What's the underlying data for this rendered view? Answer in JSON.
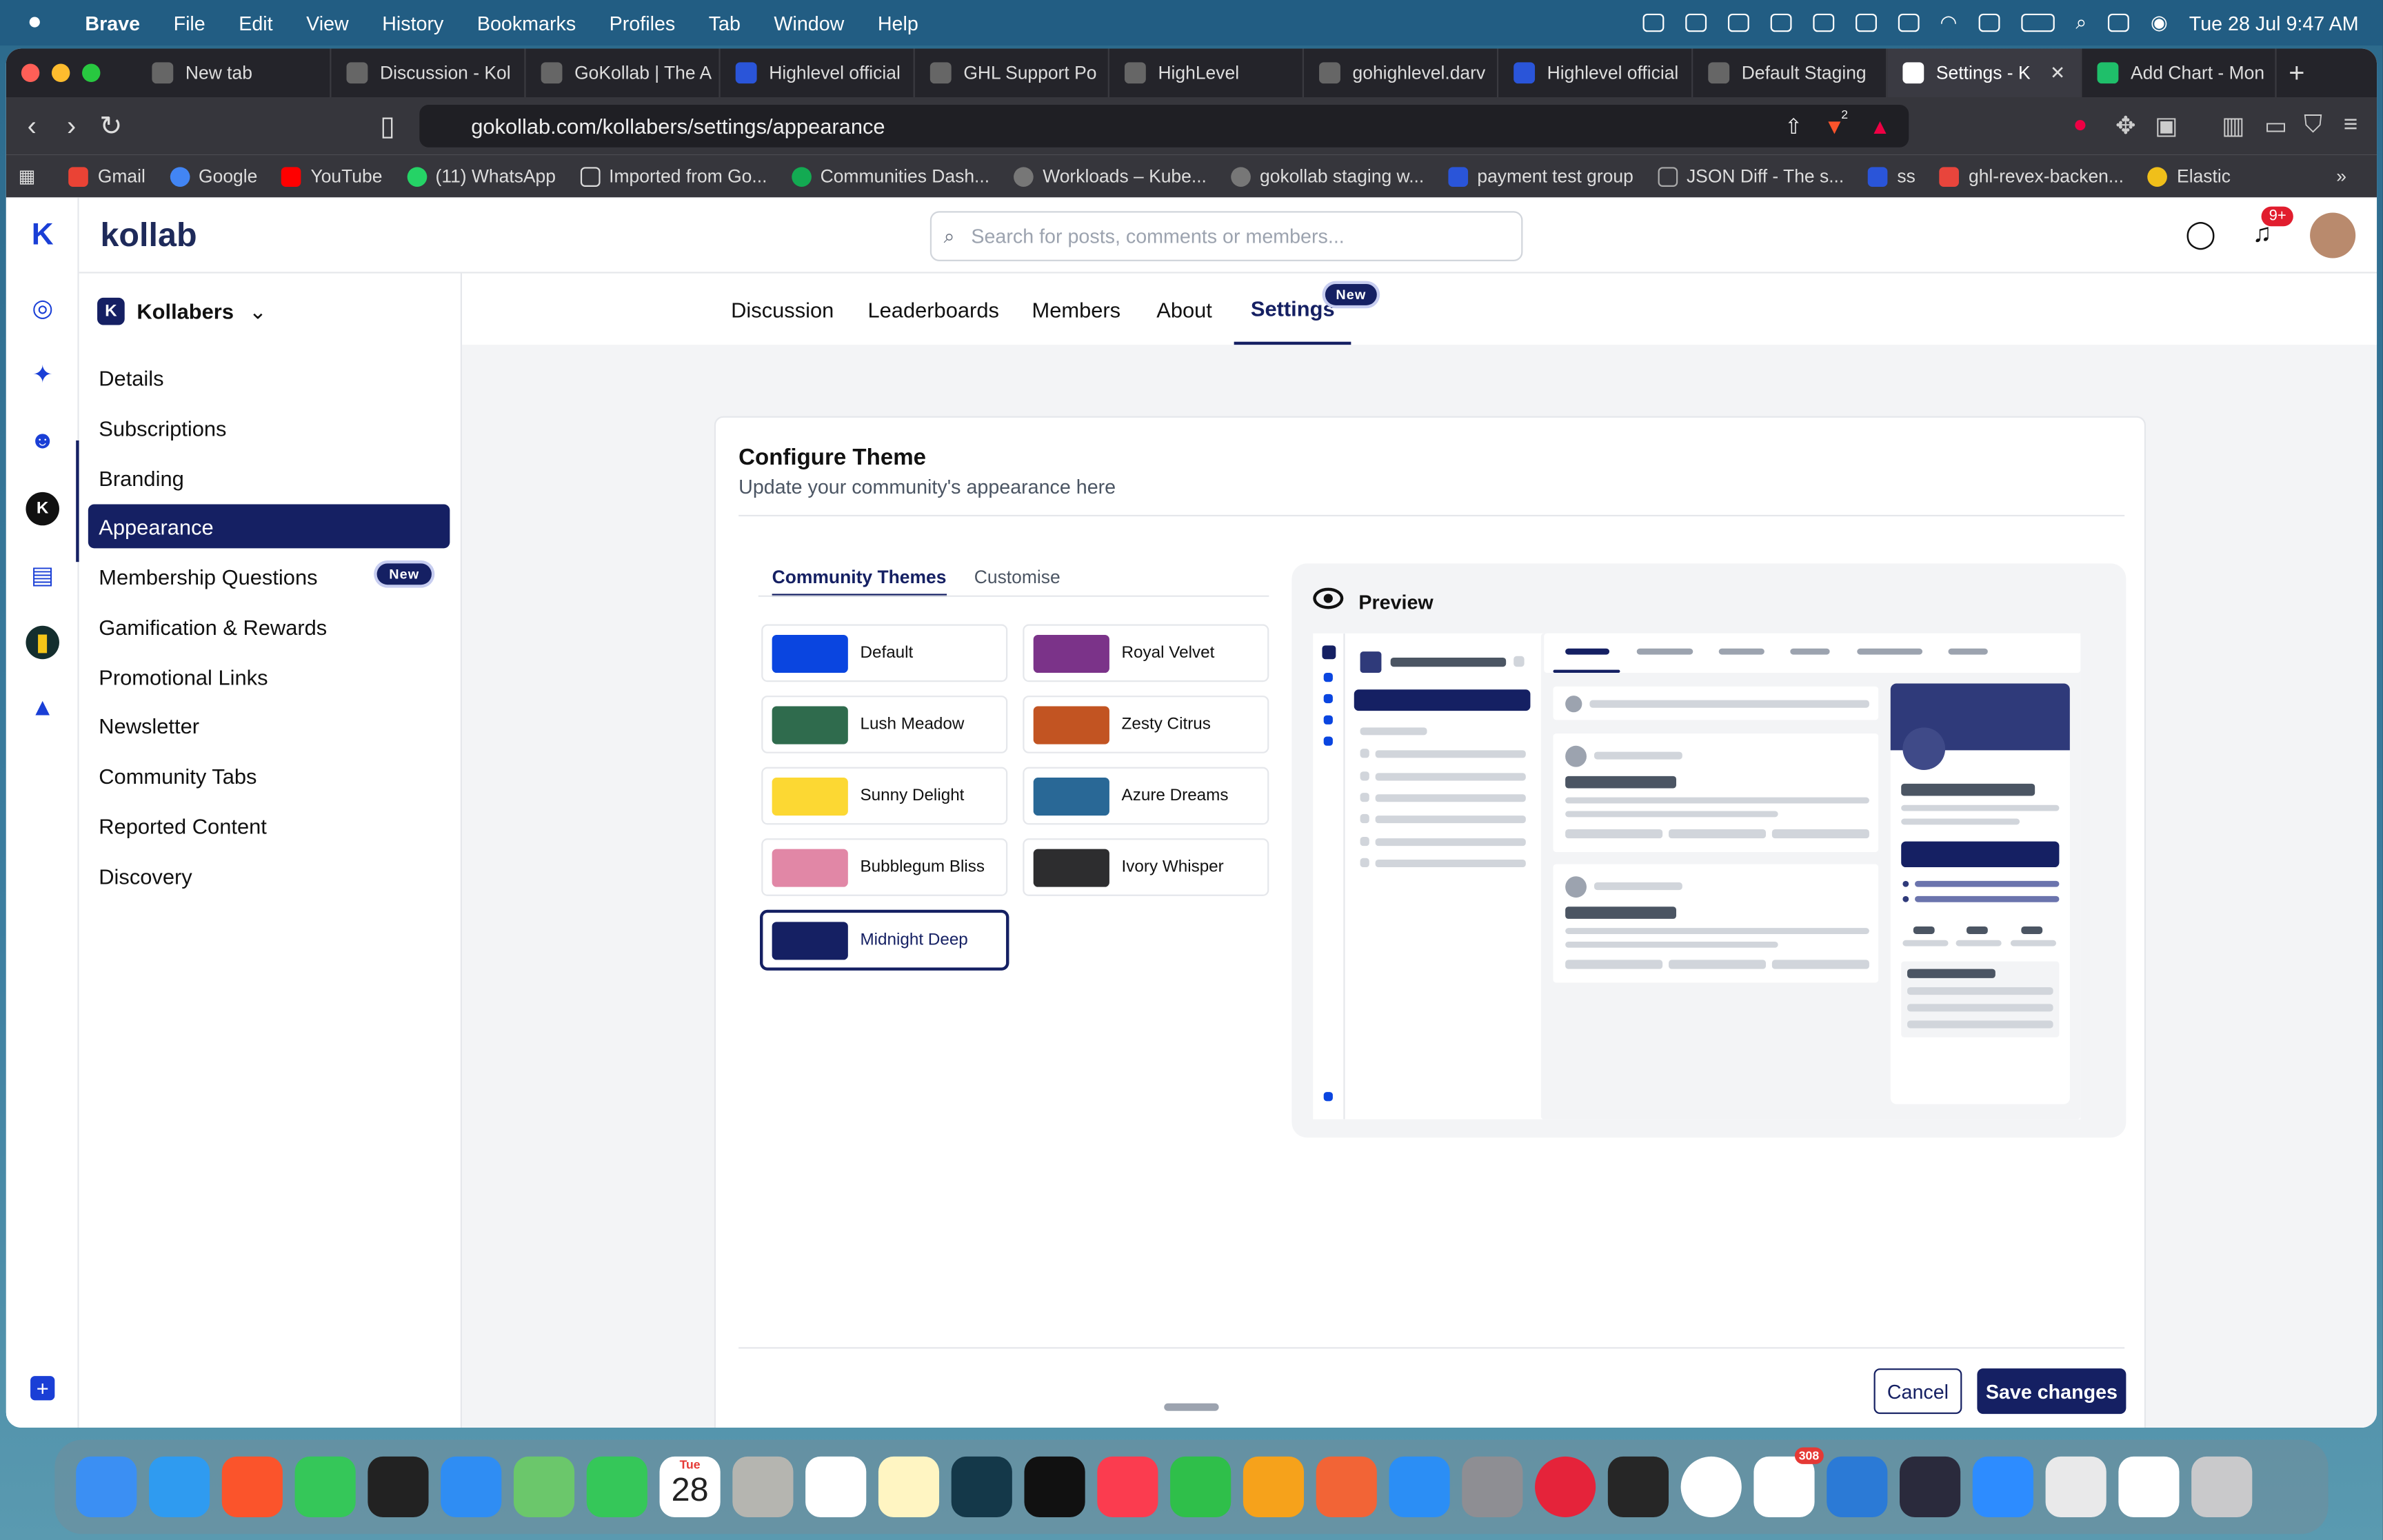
{
  "menubar": {
    "app": "Brave",
    "items": [
      "File",
      "Edit",
      "View",
      "History",
      "Bookmarks",
      "Profiles",
      "Tab",
      "Window",
      "Help"
    ],
    "clock": "Tue 28 Jul  9:47 AM"
  },
  "tabs": [
    {
      "label": "New tab"
    },
    {
      "label": "Discussion - Kol"
    },
    {
      "label": "GoKollab | The A"
    },
    {
      "label": "Highlevel official"
    },
    {
      "label": "GHL Support Po"
    },
    {
      "label": "HighLevel"
    },
    {
      "label": "gohighlevel.darv"
    },
    {
      "label": "Highlevel official"
    },
    {
      "label": "Default Staging"
    },
    {
      "label": "Settings - K"
    },
    {
      "label": "Add Chart - Mon"
    }
  ],
  "address": {
    "url": "gokollab.com/kollabers/settings/appearance",
    "shields_count": "2"
  },
  "bookmarks": [
    "Gmail",
    "Google",
    "YouTube",
    "(11) WhatsApp",
    "Imported from Go...",
    "Communities Dash...",
    "Workloads – Kube...",
    "gokollab staging w...",
    "payment test group",
    "JSON Diff - The s...",
    "ss",
    "ghl-revex-backen...",
    "Elastic"
  ],
  "app": {
    "logo": "kollab",
    "search_placeholder": "Search for posts, comments or members...",
    "notif_count": "9+",
    "community_name": "Kollabers",
    "community_initial": "K",
    "sidebar": [
      {
        "label": "Details"
      },
      {
        "label": "Subscriptions"
      },
      {
        "label": "Branding"
      },
      {
        "label": "Appearance",
        "active": true
      },
      {
        "label": "Membership Questions",
        "badge": "New"
      },
      {
        "label": "Gamification & Rewards"
      },
      {
        "label": "Promotional Links"
      },
      {
        "label": "Newsletter"
      },
      {
        "label": "Community Tabs"
      },
      {
        "label": "Reported Content"
      },
      {
        "label": "Discovery"
      }
    ],
    "content_tabs": [
      {
        "label": "Discussion"
      },
      {
        "label": "Leaderboards"
      },
      {
        "label": "Members"
      },
      {
        "label": "About"
      },
      {
        "label": "Settings",
        "active": true
      }
    ],
    "settings_badge": "New",
    "card": {
      "title": "Configure Theme",
      "subtitle": "Update your community's appearance here",
      "theme_tabs": [
        {
          "label": "Community Themes",
          "active": true
        },
        {
          "label": "Customise"
        }
      ],
      "themes": [
        {
          "name": "Default",
          "color": "#0a45e0"
        },
        {
          "name": "Royal Velvet",
          "color": "#7b3389"
        },
        {
          "name": "Lush Meadow",
          "color": "#2f6b4d"
        },
        {
          "name": "Zesty Citrus",
          "color": "#c25422"
        },
        {
          "name": "Sunny Delight",
          "color": "#fcd833"
        },
        {
          "name": "Azure Dreams",
          "color": "#296896"
        },
        {
          "name": "Bubblegum Bliss",
          "color": "#e187a6"
        },
        {
          "name": "Ivory Whisper",
          "color": "#2d2d2f"
        },
        {
          "name": "Midnight Deep",
          "color": "#152063",
          "selected": true
        }
      ],
      "preview_title": "Preview",
      "cancel": "Cancel",
      "save": "Save changes"
    }
  },
  "dock": {
    "calendar_month": "Tue",
    "calendar_day": "28",
    "slack_badge": "308"
  }
}
